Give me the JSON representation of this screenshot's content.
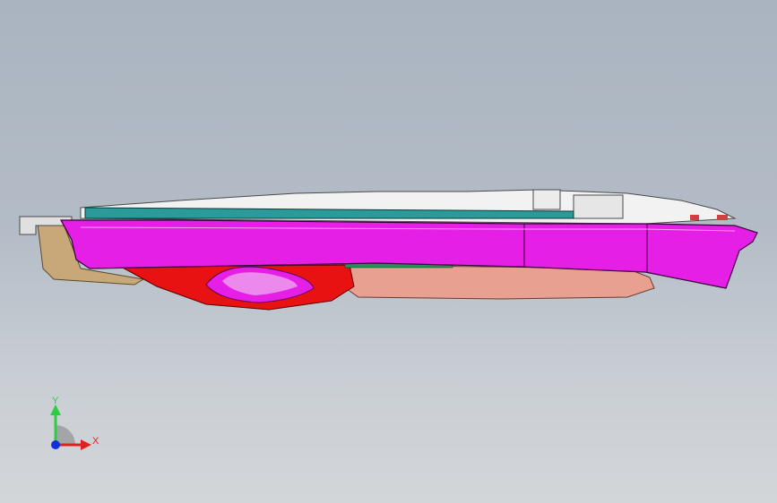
{
  "viewport": {
    "background_top": "#aab4c0",
    "background_bottom": "#d3d6d9"
  },
  "model": {
    "parts": [
      {
        "name": "magenta-housing",
        "color": "#e61fe6"
      },
      {
        "name": "red-trigger-part",
        "color": "#e81212"
      },
      {
        "name": "salmon-lower-body",
        "color": "#e8a090"
      },
      {
        "name": "tan-rear-part",
        "color": "#c8a878"
      },
      {
        "name": "green-pcb-board",
        "color": "#2e8b57"
      },
      {
        "name": "teal-cover-plate",
        "color": "#2a9a9a"
      },
      {
        "name": "white-internal-components",
        "color": "#f2f2f2"
      }
    ]
  },
  "triad": {
    "y_label": "Y",
    "x_label": "X",
    "y_color": "#2ecc40",
    "x_color": "#e02020",
    "z_color": "#1030e0"
  }
}
